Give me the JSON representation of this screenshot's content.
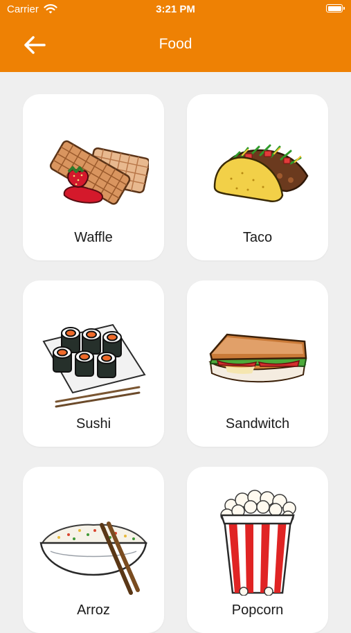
{
  "status_bar": {
    "carrier": "Carrier",
    "time": "3:21 PM"
  },
  "nav": {
    "title": "Food",
    "back_icon": "arrow-left-icon"
  },
  "colors": {
    "accent": "#ee8104",
    "background": "#efefef",
    "card": "#ffffff"
  },
  "items": [
    {
      "label": "Waffle",
      "icon": "waffle-illustration"
    },
    {
      "label": "Taco",
      "icon": "taco-illustration"
    },
    {
      "label": "Sushi",
      "icon": "sushi-illustration"
    },
    {
      "label": "Sandwitch",
      "icon": "sandwich-illustration"
    },
    {
      "label": "Arroz",
      "icon": "rice-bowl-illustration"
    },
    {
      "label": "Popcorn",
      "icon": "popcorn-illustration"
    }
  ]
}
